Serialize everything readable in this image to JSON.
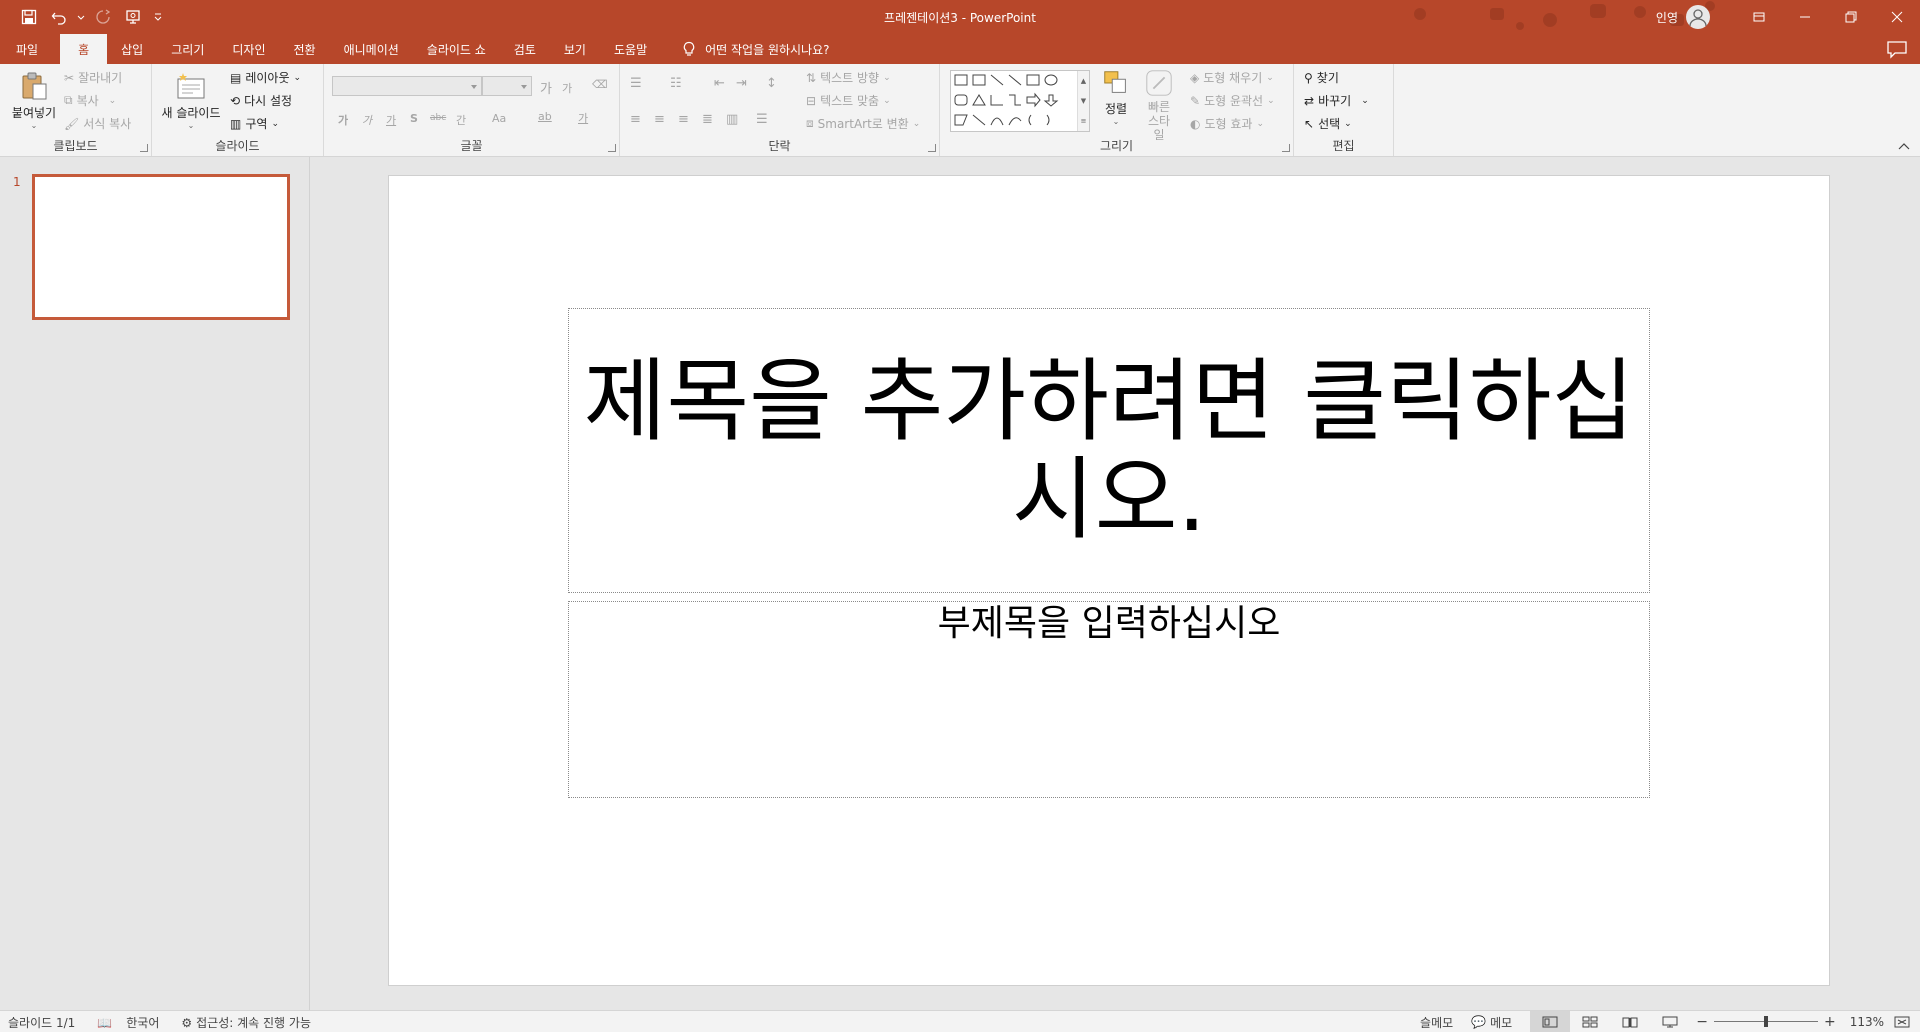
{
  "window": {
    "title": "프레젠테이션3  -  PowerPoint",
    "user": "인영",
    "accent_color": "#b7472a"
  },
  "tabs": [
    "파일",
    "홈",
    "삽입",
    "그리기",
    "디자인",
    "전환",
    "애니메이션",
    "슬라이드 쇼",
    "검토",
    "보기",
    "도움말"
  ],
  "active_tab": "홈",
  "tell_me": "어떤 작업을 원하시나요?",
  "ribbon": {
    "clipboard": {
      "label": "클립보드",
      "paste": "붙여넣기",
      "cut": "잘라내기",
      "copy": "복사",
      "format_painter": "서식 복사"
    },
    "slides": {
      "label": "슬라이드",
      "new_slide": "새 슬라이드",
      "layout": "레이아웃",
      "reset": "다시 설정",
      "section": "구역"
    },
    "font": {
      "label": "글꼴",
      "grow": "가",
      "shrink": "가",
      "bold": "가",
      "italic": "가",
      "underline": "가",
      "shadow": "S",
      "strike": "abc",
      "spacing": "간",
      "case": "Aa",
      "highlight": "ab",
      "color": "가"
    },
    "paragraph": {
      "label": "단락",
      "text_direction": "텍스트 방향",
      "align_text": "텍스트 맞춤",
      "smartart": "SmartArt로 변환"
    },
    "drawing": {
      "label": "그리기",
      "arrange": "정렬",
      "quick_styles": "빠른 스타일",
      "shape_fill": "도형 채우기",
      "shape_outline": "도형 윤곽선",
      "shape_effects": "도형 효과"
    },
    "editing": {
      "label": "편집",
      "find": "찾기",
      "replace": "바꾸기",
      "select": "선택"
    }
  },
  "thumbnails": [
    {
      "number": "1"
    }
  ],
  "slide": {
    "title_placeholder": "제목을 추가하려면 클릭하십시오.",
    "subtitle_placeholder": "부제목을 입력하십시오"
  },
  "status": {
    "slide_count": "슬라이드 1/1",
    "language": "한국어",
    "accessibility": "접근성: 계속 진행 가능",
    "notes": "슬메모",
    "comments": "메모",
    "zoom": "113%",
    "zoom_level": 0.5
  }
}
